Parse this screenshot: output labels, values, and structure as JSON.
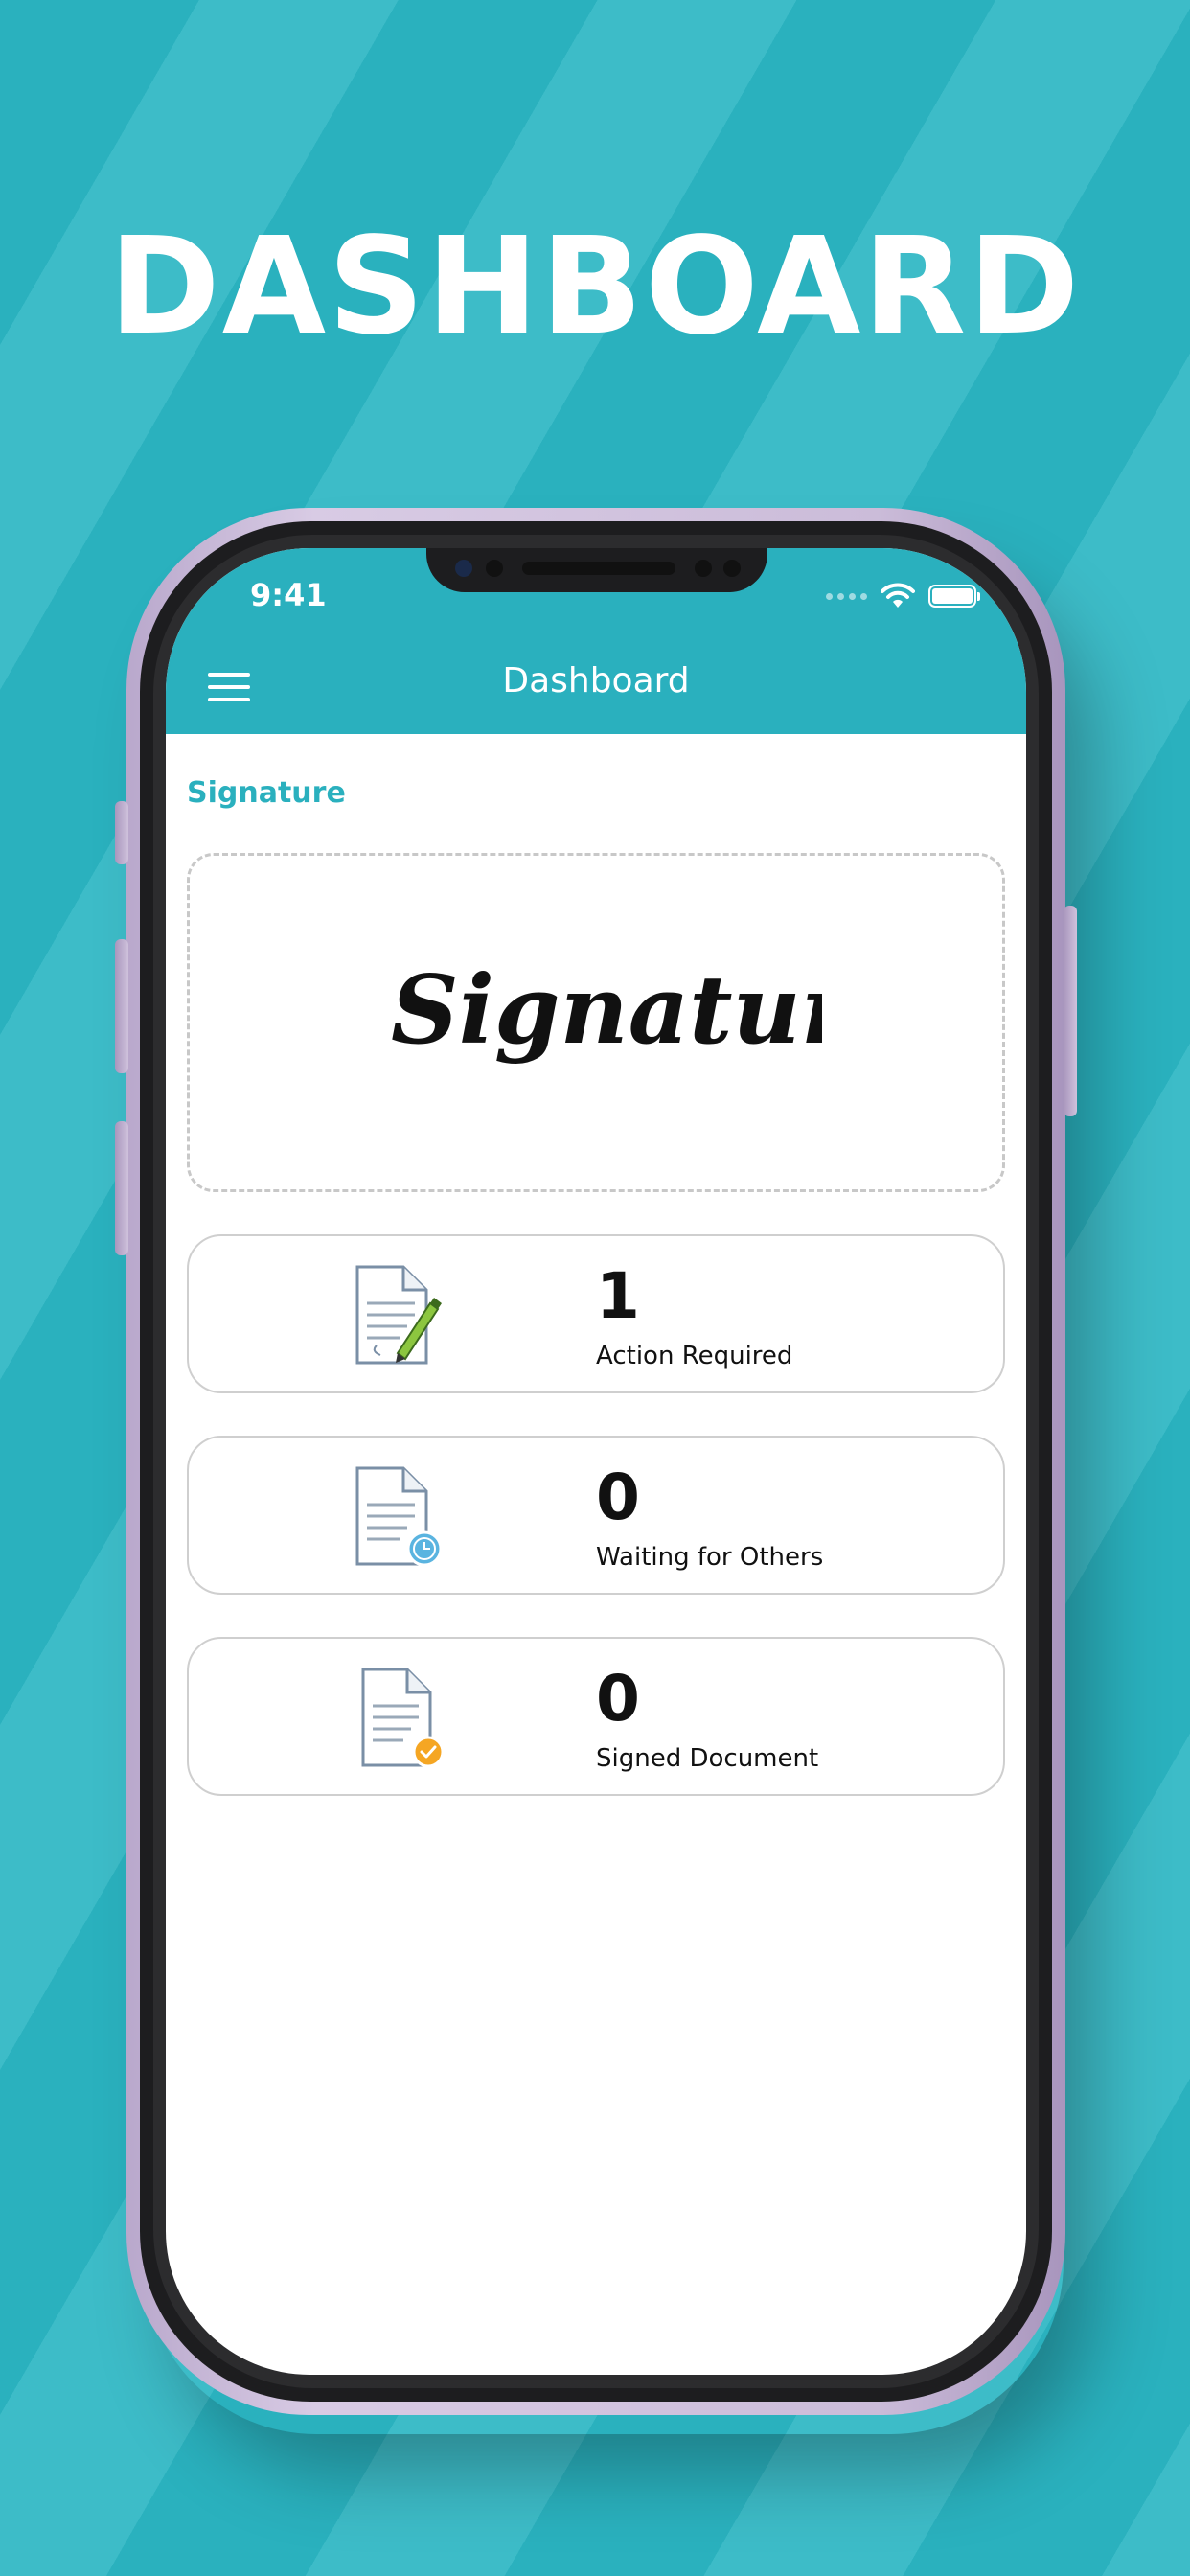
{
  "headline": "DASHBOARD",
  "status_bar": {
    "time": "9:41"
  },
  "app_bar": {
    "title": "Dashboard"
  },
  "signature_section": {
    "label": "Signature",
    "signature_text": "Signature"
  },
  "stats": [
    {
      "count": "1",
      "label": "Action Required",
      "icon": "document-pen-icon"
    },
    {
      "count": "0",
      "label": "Waiting for Others",
      "icon": "document-clock-icon"
    },
    {
      "count": "0",
      "label": "Signed Document",
      "icon": "document-check-icon"
    }
  ],
  "colors": {
    "accent": "#2ab0be",
    "background": "#2bb3c0",
    "phone_frame": "#cbbcd9"
  }
}
